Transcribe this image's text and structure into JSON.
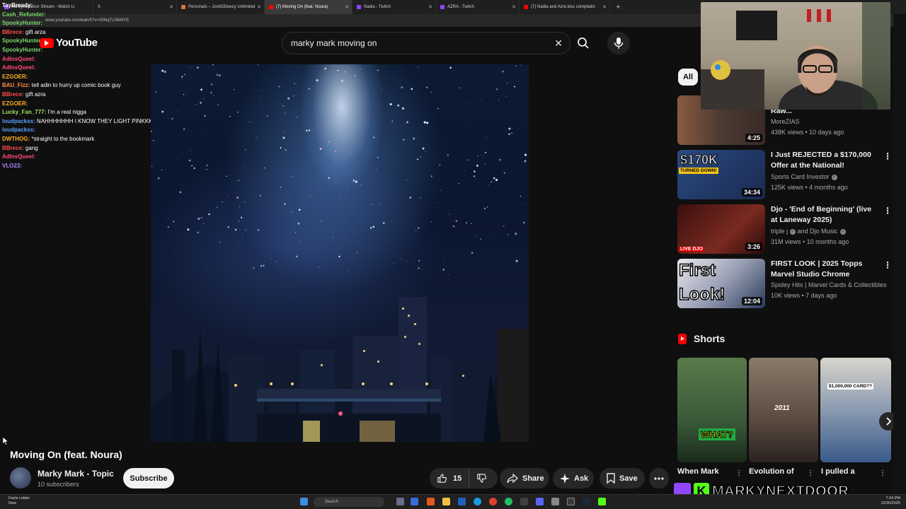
{
  "browser": {
    "tabs": [
      {
        "label": "markynextdoor Stream - Watch Li",
        "color": "#9146ff",
        "active": false
      },
      {
        "label": "X",
        "color": "#ffffff",
        "active": false
      },
      {
        "label": "Personals – JoshODeezy Unlimited",
        "color": "#e0723a",
        "active": false
      },
      {
        "label": "(7) Moving On (feat. Noura)",
        "color": "#ff0000",
        "active": true
      },
      {
        "label": "Nadia - Twitch",
        "color": "#9146ff",
        "active": false
      },
      {
        "label": "AZRA - Twitch",
        "color": "#9146ff",
        "active": false
      },
      {
        "label": "(7) Nadia and Azra kiss compilatio",
        "color": "#ff0000",
        "active": false
      }
    ],
    "new_tab": "+",
    "url": "www.youtube.com/watch?v=XIlNqTLNM4YE"
  },
  "youtube": {
    "logo_text": "YouTube",
    "search_value": "marky mark moving on",
    "clear_glyph": "✕"
  },
  "video": {
    "title": "Moving On (feat. Noura)",
    "channel": "Marky Mark - Topic",
    "subscribers": "10 subscribers",
    "subscribe_label": "Subscribe",
    "likes": "15",
    "share_label": "Share",
    "ask_label": "Ask",
    "save_label": "Save"
  },
  "chat": [
    {
      "user": "TayBready:",
      "color": "#ffffff",
      "msg": ""
    },
    {
      "user": "Cash_Refunder:",
      "color": "#7bd66b",
      "msg": ""
    },
    {
      "user": "SpookyHunter:",
      "color": "#7bd66b",
      "msg": ""
    },
    {
      "user": "BBrece:",
      "color": "#ff4d4d",
      "msg": "gift arza"
    },
    {
      "user": "SpookyHunter:",
      "color": "#7bd66b",
      "msg": ""
    },
    {
      "user": "SpookyHunter:",
      "color": "#7bd66b",
      "msg": ""
    },
    {
      "user": "AdInsQueel:",
      "color": "#ff4d7a",
      "msg": ""
    },
    {
      "user": "AdInsQueel:",
      "color": "#ff4d7a",
      "msg": ""
    },
    {
      "user": "EZGOER:",
      "color": "#ffb020",
      "msg": ""
    },
    {
      "user": "BAU_Fizz:",
      "color": "#ff9040",
      "msg": "tell adin to hurry up comic book guy"
    },
    {
      "user": "BBrece:",
      "color": "#ff4d4d",
      "msg": "gift azra"
    },
    {
      "user": "EZGOER:",
      "color": "#ffb020",
      "msg": ""
    },
    {
      "user": "Lucky_Fan_777:",
      "color": "#a0e060",
      "msg": "I'm a real nigga"
    },
    {
      "user": "loudpackss:",
      "color": "#5aa0ff",
      "msg": "NAHHHHHHH I KNOW THEY LIGHT PINKKKK"
    },
    {
      "user": "loudpackss:",
      "color": "#5aa0ff",
      "msg": ""
    },
    {
      "user": "DWTHOG:",
      "color": "#ffb020",
      "msg": "*straight to the bookmark"
    },
    {
      "user": "BBrece:",
      "color": "#ff4d4d",
      "msg": "gang"
    },
    {
      "user": "AdInsQueel:",
      "color": "#ff4d7a",
      "msg": ""
    },
    {
      "user": "VLO23:",
      "color": "#b080ff",
      "msg": ""
    }
  ],
  "sidebar": {
    "chip_all": "All",
    "recommendations": [
      {
        "title": "ft. Timothée Chalamet - 4 Raw...",
        "channel": "MoreZIAS",
        "meta": "438K views • 10 days ago",
        "duration": "4:25",
        "bg": "#6a4a3a"
      },
      {
        "title": "I Just REJECTED a $170,000 Offer at the National!",
        "channel": "Sports Card Investor",
        "verified": true,
        "meta": "125K views • 4 months ago",
        "duration": "34:34",
        "bg": "#2c4a7a"
      },
      {
        "title": "Djo - 'End of Beginning' (live at Laneway 2025)",
        "channel": "triple j",
        "channel2": "and Djo Music",
        "verified": true,
        "meta": "31M views • 10 months ago",
        "duration": "3:26",
        "bg": "#5a1a1a"
      },
      {
        "title": "FIRST LOOK | 2025 Topps Marvel Studio Chrome",
        "channel": "Spidey Hits | Marvel Cards & Collectibles",
        "meta": "10K views • 7 days ago",
        "duration": "12:04",
        "bg": "#1a2a4a"
      }
    ],
    "shorts_label": "Shorts",
    "shorts": [
      {
        "title": "When Mark",
        "overlay": "WHAT?",
        "bg": "#4a6a3a"
      },
      {
        "title": "Evolution of",
        "overlay": "2011",
        "bg": "#7a6a5a"
      },
      {
        "title": "I pulled a",
        "overlay": "$1,000,000 CARD??",
        "bg": "#3a4a6a"
      }
    ],
    "thumb_texts": {
      "r2_big": "$170K",
      "r2_small": "TURNED DOWN!",
      "r4_big": "First Look!",
      "r3_badge": "LIVE DJO"
    }
  },
  "overlay": {
    "brand_k": "K",
    "brand_name": "MARKYNEXTDOOR"
  },
  "taskbar": {
    "weather_line1": "Feels colder",
    "weather_line2": "Now",
    "search_placeholder": "Search",
    "time": "7:34 PM",
    "date": "12/30/2025"
  },
  "colors": {
    "youtube_red": "#ff0000",
    "twitch_purple": "#9146ff",
    "kick_green": "#53fc18",
    "background": "#0f0f0f"
  }
}
